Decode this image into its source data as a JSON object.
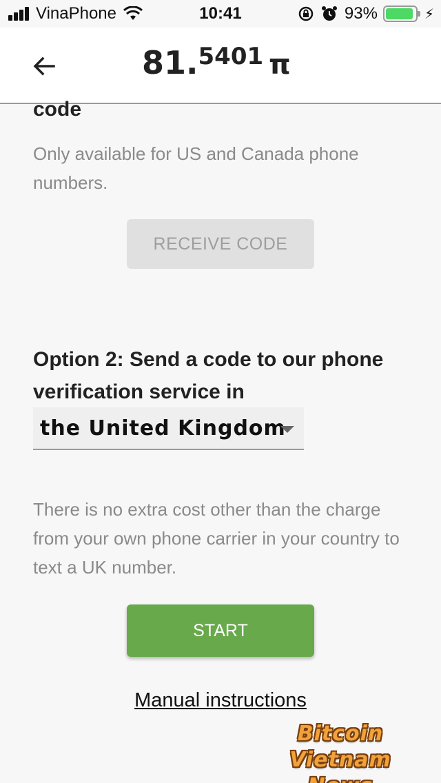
{
  "status_bar": {
    "carrier": "VinaPhone",
    "time": "10:41",
    "battery_percent": "93%",
    "battery_level": 0.93,
    "icons": [
      "signal-icon",
      "wifi-icon",
      "orientation-lock-icon",
      "alarm-icon",
      "battery-icon",
      "charging-icon"
    ]
  },
  "header": {
    "balance_int": "81.",
    "balance_dec": "5401",
    "balance_currency": "π",
    "back_icon": "back-arrow-icon"
  },
  "option1": {
    "title_fragment": "code",
    "note": "Only available for US and Canada phone numbers.",
    "button_label": "RECEIVE CODE"
  },
  "option2": {
    "title": "Option 2: Send a code to our phone verification service in",
    "country_selected": "the United Kingdom",
    "note": "There is no extra cost other than the charge from your own phone carrier in your country to text a UK number.",
    "button_label": "START"
  },
  "links": {
    "manual": "Manual instructions"
  },
  "watermark": {
    "line1": "Bitcoin Vietnam",
    "line2": "News"
  },
  "colors": {
    "start_button": "#68a94c",
    "receive_button_disabled": "#e0e0e0",
    "battery_green": "#4cd964",
    "muted_text": "#8a8a8a"
  }
}
